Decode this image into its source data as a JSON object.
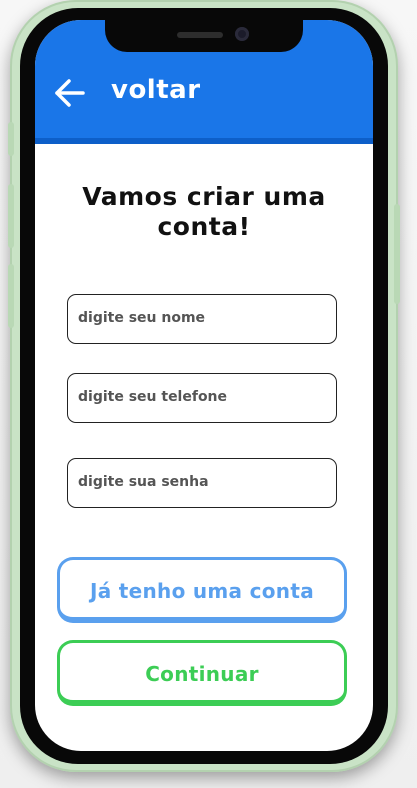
{
  "header": {
    "back_label": "voltar",
    "back_icon": "arrow-left-icon",
    "color": "#1a76e8"
  },
  "main": {
    "title": "Vamos criar uma conta!",
    "fields": [
      {
        "placeholder": "digite seu nome"
      },
      {
        "placeholder": "digite seu telefone"
      },
      {
        "placeholder": "digite sua senha"
      }
    ],
    "secondary_button": {
      "label": "Já tenho uma conta",
      "color": "#5aa0ee"
    },
    "primary_button": {
      "label": "Continuar",
      "color": "#3ccd55"
    }
  }
}
